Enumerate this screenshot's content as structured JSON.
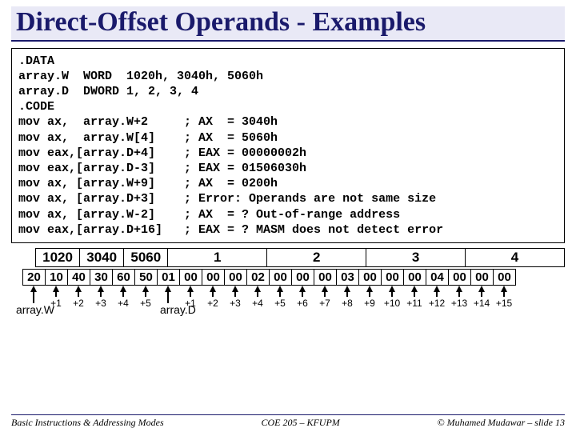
{
  "title": "Direct-Offset Operands - Examples",
  "code_lines": [
    ".DATA",
    "array.W  WORD  1020h, 3040h, 5060h",
    "array.D  DWORD 1, 2, 3, 4",
    ".CODE",
    "mov ax,  array.W+2     ; AX  = 3040h",
    "mov ax,  array.W[4]    ; AX  = 5060h",
    "mov eax,[array.D+4]    ; EAX = 00000002h",
    "mov eax,[array.D-3]    ; EAX = 01506030h",
    "mov ax, [array.W+9]    ; AX  = 0200h",
    "mov ax, [array.D+3]    ; Error: Operands are not same size",
    "mov ax, [array.W-2]    ; AX  = ? Out-of-range address",
    "mov eax,[array.D+16]   ; EAX = ? MASM does not detect error"
  ],
  "word_cells": [
    "1020",
    "3040",
    "5060",
    "1",
    "2",
    "3",
    "4"
  ],
  "byte_cells": [
    "20",
    "10",
    "40",
    "30",
    "60",
    "50",
    "01",
    "00",
    "00",
    "00",
    "02",
    "00",
    "00",
    "00",
    "03",
    "00",
    "00",
    "00",
    "04",
    "00",
    "00",
    "00"
  ],
  "offsets": [
    "+1",
    "+2",
    "+3",
    "+4",
    "+5",
    "+1",
    "+2",
    "+3",
    "+4",
    "+5",
    "+6",
    "+7",
    "+8",
    "+9",
    "+10",
    "+11",
    "+12",
    "+13",
    "+14",
    "+15"
  ],
  "array_labels": {
    "w": "array.W",
    "d": "array.D"
  },
  "footer": {
    "left": "Basic Instructions & Addressing Modes",
    "center": "COE 205 – KFUPM",
    "right": "© Muhamed Mudawar – slide 13"
  }
}
